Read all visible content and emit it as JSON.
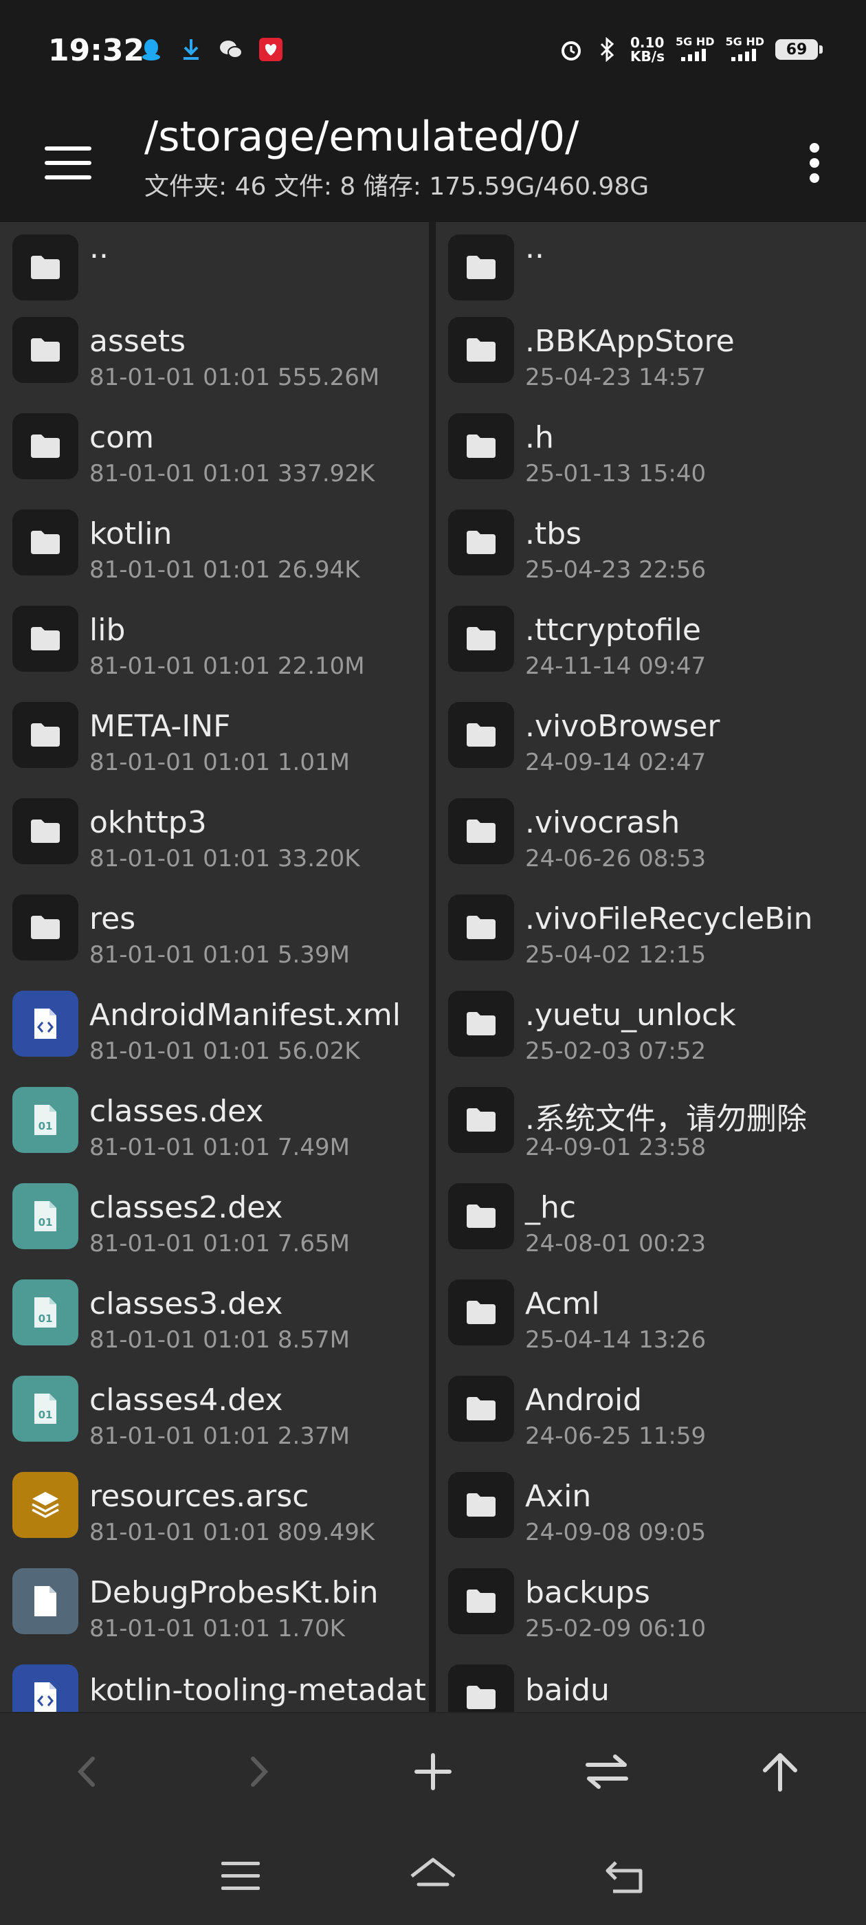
{
  "status_bar": {
    "time": "19:32",
    "left_icons": [
      "qq-icon",
      "download-icon",
      "wechat-icon",
      "app-icon"
    ],
    "net_speed_value": "0.10",
    "net_speed_unit": "KB/s",
    "sim1": "5G HD",
    "sim2": "5G HD",
    "battery": "69"
  },
  "header": {
    "path": "/storage/emulated/0/",
    "summary": "文件夹: 46  文件: 8  储存: 175.59G/460.98G"
  },
  "left_pane": {
    "items": [
      {
        "name": "..",
        "meta": "",
        "type": "folder"
      },
      {
        "name": "assets",
        "meta": "81-01-01 01:01  555.26M",
        "type": "folder"
      },
      {
        "name": "com",
        "meta": "81-01-01 01:01  337.92K",
        "type": "folder"
      },
      {
        "name": "kotlin",
        "meta": "81-01-01 01:01  26.94K",
        "type": "folder"
      },
      {
        "name": "lib",
        "meta": "81-01-01 01:01  22.10M",
        "type": "folder"
      },
      {
        "name": "META-INF",
        "meta": "81-01-01 01:01  1.01M",
        "type": "folder"
      },
      {
        "name": "okhttp3",
        "meta": "81-01-01 01:01  33.20K",
        "type": "folder"
      },
      {
        "name": "res",
        "meta": "81-01-01 01:01  5.39M",
        "type": "folder"
      },
      {
        "name": "AndroidManifest.xml",
        "meta": "81-01-01 01:01  56.02K",
        "type": "xml"
      },
      {
        "name": "classes.dex",
        "meta": "81-01-01 01:01  7.49M",
        "type": "dex"
      },
      {
        "name": "classes2.dex",
        "meta": "81-01-01 01:01  7.65M",
        "type": "dex"
      },
      {
        "name": "classes3.dex",
        "meta": "81-01-01 01:01  8.57M",
        "type": "dex"
      },
      {
        "name": "classes4.dex",
        "meta": "81-01-01 01:01  2.37M",
        "type": "dex"
      },
      {
        "name": "resources.arsc",
        "meta": "81-01-01 01:01  809.49K",
        "type": "arsc"
      },
      {
        "name": "DebugProbesKt.bin",
        "meta": "81-01-01 01:01  1.70K",
        "type": "bin"
      },
      {
        "name": "kotlin-tooling-metadat",
        "meta": "",
        "type": "xml"
      }
    ]
  },
  "right_pane": {
    "items": [
      {
        "name": "..",
        "meta": "",
        "type": "folder"
      },
      {
        "name": ".BBKAppStore",
        "meta": "25-04-23 14:57",
        "type": "folder"
      },
      {
        "name": ".h",
        "meta": "25-01-13 15:40",
        "type": "folder"
      },
      {
        "name": ".tbs",
        "meta": "25-04-23 22:56",
        "type": "folder"
      },
      {
        "name": ".ttcryptofile",
        "meta": "24-11-14 09:47",
        "type": "folder"
      },
      {
        "name": ".vivoBrowser",
        "meta": "24-09-14 02:47",
        "type": "folder"
      },
      {
        "name": ".vivocrash",
        "meta": "24-06-26 08:53",
        "type": "folder"
      },
      {
        "name": ".vivoFileRecycleBin",
        "meta": "25-04-02 12:15",
        "type": "folder"
      },
      {
        "name": ".yuetu_unlock",
        "meta": "25-02-03 07:52",
        "type": "folder"
      },
      {
        "name": ".系统文件，请勿删除",
        "meta": "24-09-01 23:58",
        "type": "folder"
      },
      {
        "name": "_hc",
        "meta": "24-08-01 00:23",
        "type": "folder"
      },
      {
        "name": "Acml",
        "meta": "25-04-14 13:26",
        "type": "folder"
      },
      {
        "name": "Android",
        "meta": "24-06-25 11:59",
        "type": "folder"
      },
      {
        "name": "Axin",
        "meta": "24-09-08 09:05",
        "type": "folder"
      },
      {
        "name": "backups",
        "meta": "25-02-09 06:10",
        "type": "folder"
      },
      {
        "name": "baidu",
        "meta": "",
        "type": "folder"
      }
    ]
  },
  "toolbar": {
    "buttons": [
      "back-arrow-icon",
      "forward-arrow-icon",
      "add-icon",
      "swap-icon",
      "up-arrow-icon"
    ]
  },
  "navbar": {
    "buttons": [
      "menu-icon",
      "home-icon",
      "back-icon"
    ]
  }
}
